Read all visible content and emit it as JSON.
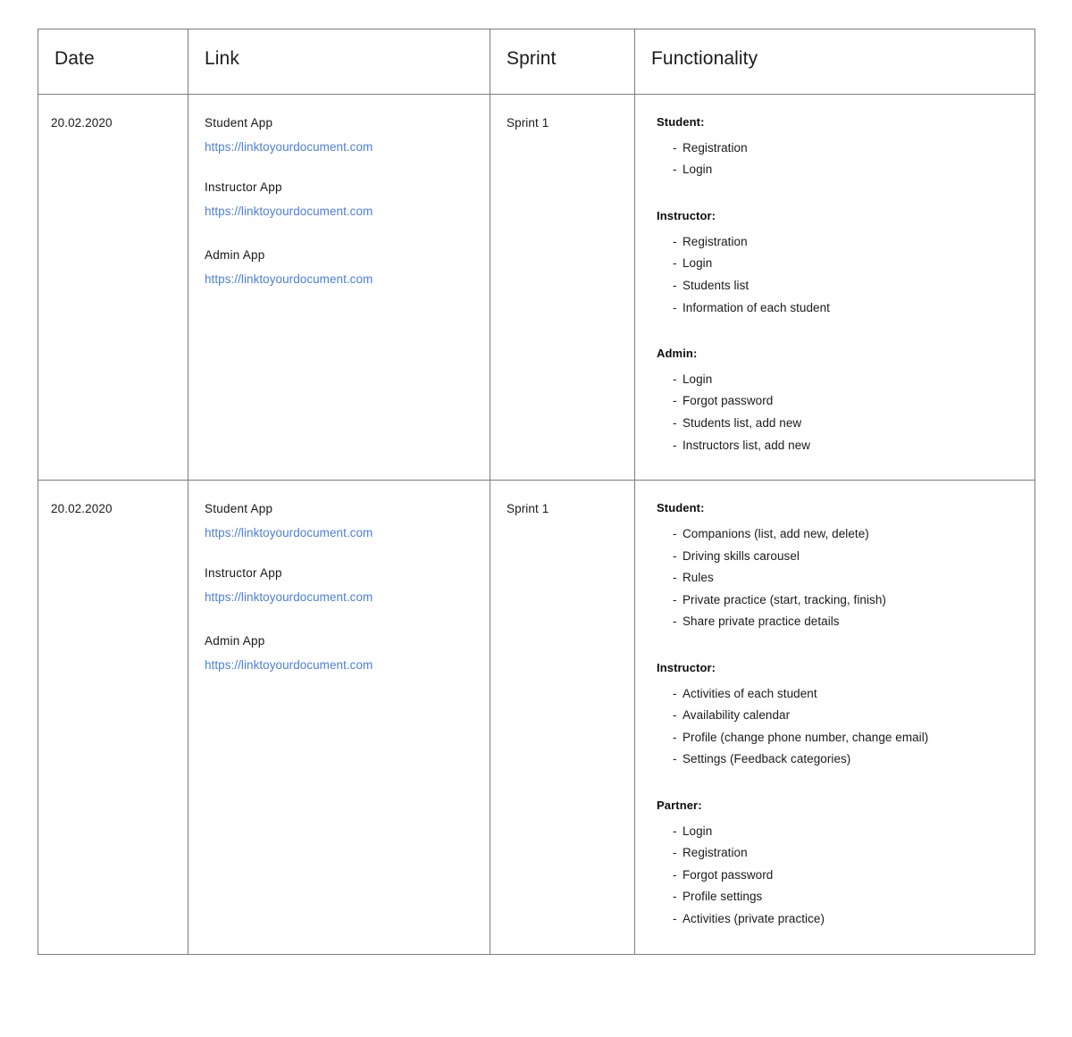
{
  "table": {
    "columns": [
      {
        "id": "date",
        "label": "Date"
      },
      {
        "id": "link",
        "label": "Link"
      },
      {
        "id": "sprint",
        "label": "Sprint"
      },
      {
        "id": "functionality",
        "label": "Functionality"
      }
    ],
    "link_color": "#4a7fdd",
    "border_color": "#7d7d82",
    "rows": [
      {
        "date": "20.02.2020",
        "sprint": "Sprint 1",
        "links": [
          {
            "label": "Student App",
            "url": "https://linktoyourdocument.com"
          },
          {
            "label": "Instructor App",
            "url": "https://linktoyourdocument.com"
          },
          {
            "label": "Admin App",
            "url": "https://linktoyourdocument.com"
          }
        ],
        "functionality": [
          {
            "title": "Student:",
            "items": [
              "Registration",
              "Login"
            ]
          },
          {
            "title": "Instructor:",
            "items": [
              "Registration",
              "Login",
              "Students list",
              "Information of each student"
            ]
          },
          {
            "title": "Admin:",
            "items": [
              "Login",
              "Forgot password",
              "Students list, add new",
              "Instructors list, add new"
            ]
          }
        ]
      },
      {
        "date": "20.02.2020",
        "sprint": "Sprint 1",
        "links": [
          {
            "label": "Student App",
            "url": "https://linktoyourdocument.com"
          },
          {
            "label": "Instructor App",
            "url": "https://linktoyourdocument.com"
          },
          {
            "label": "Admin App",
            "url": "https://linktoyourdocument.com"
          }
        ],
        "functionality": [
          {
            "title": "Student:",
            "items": [
              "Companions (list, add new, delete)",
              "Driving skills carousel",
              "Rules",
              "Private practice (start, tracking, finish)",
              "Share private practice details"
            ]
          },
          {
            "title": "Instructor:",
            "items": [
              "Activities of each student",
              "Availability calendar",
              "Profile (change phone number, change email)",
              "Settings (Feedback categories)"
            ]
          },
          {
            "title": "Partner:",
            "items": [
              "Login",
              "Registration",
              "Forgot password",
              "Profile settings",
              "Activities (private practice)"
            ]
          }
        ]
      }
    ]
  }
}
